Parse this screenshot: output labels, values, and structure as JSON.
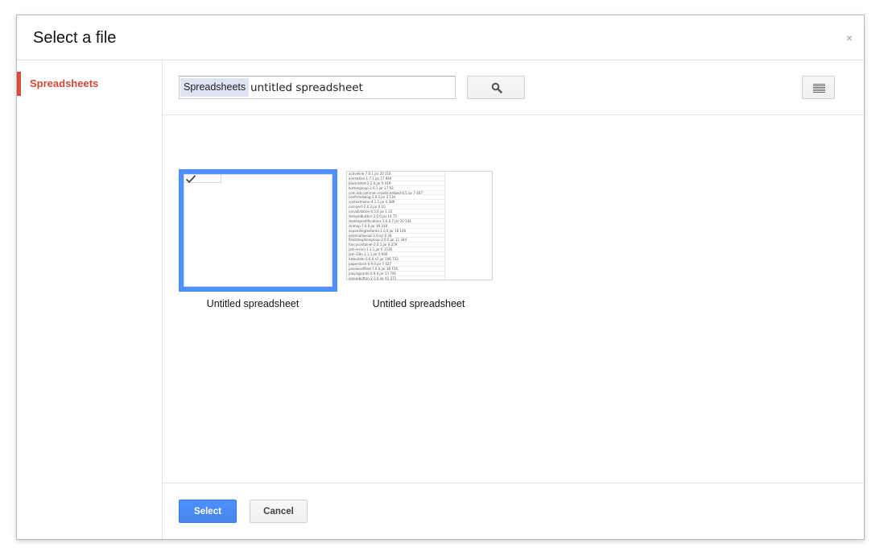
{
  "dialog": {
    "title": "Select a file",
    "close_glyph": "×"
  },
  "sidebar": {
    "items": [
      {
        "label": "Spreadsheets"
      }
    ]
  },
  "search": {
    "chip_label": "Spreadsheets",
    "value": "untitled spreadsheet",
    "search_icon": "search-icon",
    "view_icon": "list-view-icon"
  },
  "files": [
    {
      "name": "Untitled spreadsheet",
      "selected": true
    },
    {
      "name": "Untitled spreadsheet",
      "selected": false,
      "preview_rows": [
        "activelink-7.0.1.jar   20   118",
        "animation-1.7.1.jar   17   864",
        "blacklisted-2.2.0.jar   0   419",
        "buttongroup-2.0.1.jar   17   93",
        "com.tsb.common.visadis.embed-0.5.jar   7   407",
        "confirmdialog-2.0.2.jar   2   134",
        "contextmenu-4.1.1.jar   0   389",
        "cssinject-2.0.3.jar   0   10",
        "cssvalidation-0.5.0.jar   1   22",
        "delayedbutton-2.0.0.jar   14   75",
        "desktopnotifications-1.0.0.7.jar   20   144",
        "dsimap-7.0.0.jar   39   318",
        "expandingtextarea-1.0.0.jar   18   146",
        "externallayout-2.0.jar   0   36",
        "flexibleoptiongroup-2.0.0.jar   11   344",
        "fancycontainer-2.0.1.jar   8   259",
        "jam-errors-1.1.1.jar   0   1536",
        "jam-i18n-1.1.1.jar   0   940",
        "listbuilder-0.6.0.a7.jar   106   732",
        "paperstack-0.9.0.jar   7   627",
        "passwordfield-7.0.0.jar   38   156",
        "playingcards-0.9.0.jar   13   706",
        "popupbutton-2.1.0.jar   41   371"
      ]
    }
  ],
  "footer": {
    "select_label": "Select",
    "cancel_label": "Cancel"
  },
  "colors": {
    "accent_blue": "#4d90fe",
    "nav_red": "#dd4b39"
  }
}
